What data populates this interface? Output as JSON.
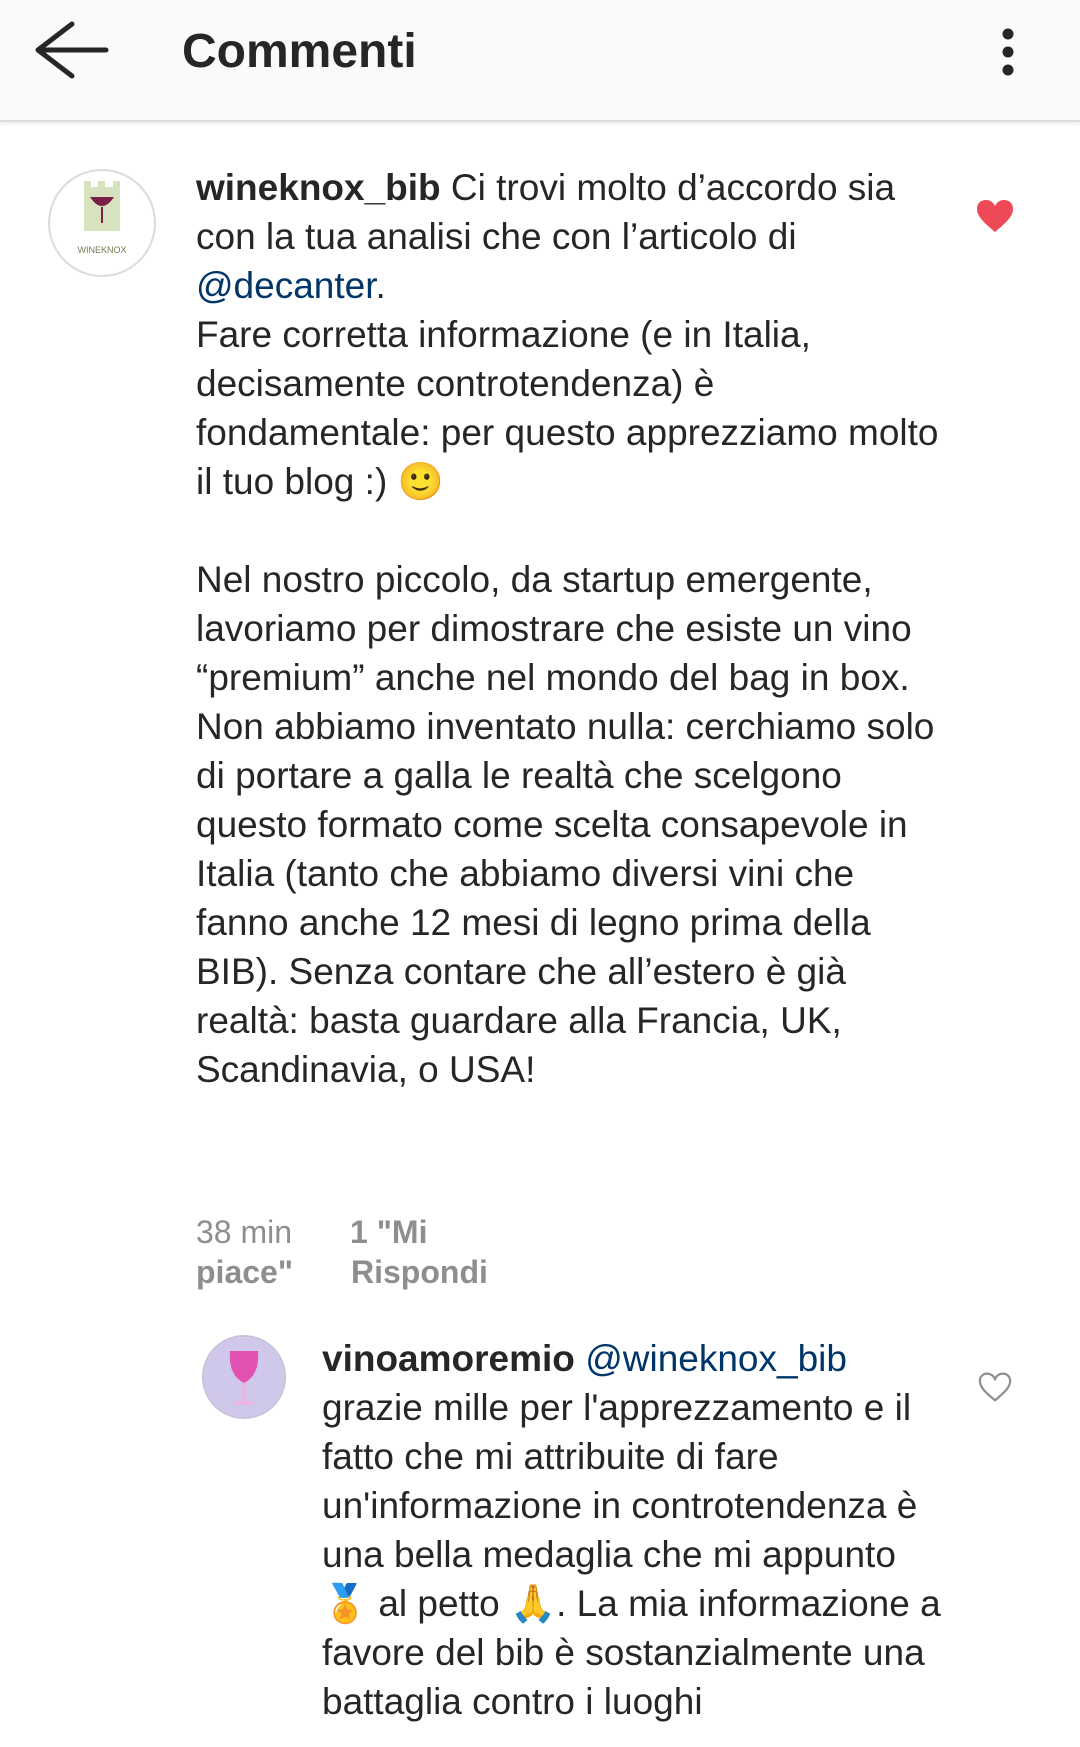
{
  "header": {
    "title": "Commenti"
  },
  "comments": [
    {
      "username": "wineknox_bib",
      "avatar_text": "WINEKNOX",
      "text_intro": " Ci trovi molto d’accordo sia con la tua analisi che con l’articolo di ",
      "mention": "@decanter",
      "text_body": ".\nFare corretta informazione (e in Italia, decisamente controtendenza) è fondamentale: per questo apprezziamo molto il tuo blog :) ",
      "emoji": "🙂",
      "text_body2": "\n\nNel nostro piccolo, da startup emergente, lavoriamo per dimostrare che esiste un vino “premium” anche nel mondo del bag in box. Non abbiamo inventato nulla: cerchiamo solo di portare a galla le realtà che scelgono questo formato come scelta consapevole in Italia (tanto che abbiamo diversi vini che fanno anche 12 mesi di legno prima della BIB). Senza contare che all’estero è già realtà: basta guardare alla Francia, UK, Scandinavia, o USA!",
      "time": "38 min",
      "likes": "1 \"Mi piace\"",
      "reply": "Rispondi",
      "liked": true
    },
    {
      "username": "vinoamoremio",
      "mention": "@wineknox_bib",
      "text_body": " grazie mille per l'apprezzamento e il fatto che mi attribuite di fare un'informazione in controtendenza è una bella medaglia che mi appunto ",
      "emoji1": "🏅",
      "text_body2": " al petto ",
      "emoji2": "🙏",
      "text_body3": ". La mia informazione a favore del bib è sostanzialmente una battaglia contro i luoghi",
      "liked": false
    }
  ],
  "colors": {
    "liked_heart": "#ed4956",
    "mention": "#003569",
    "meta": "#8e8e8e"
  }
}
